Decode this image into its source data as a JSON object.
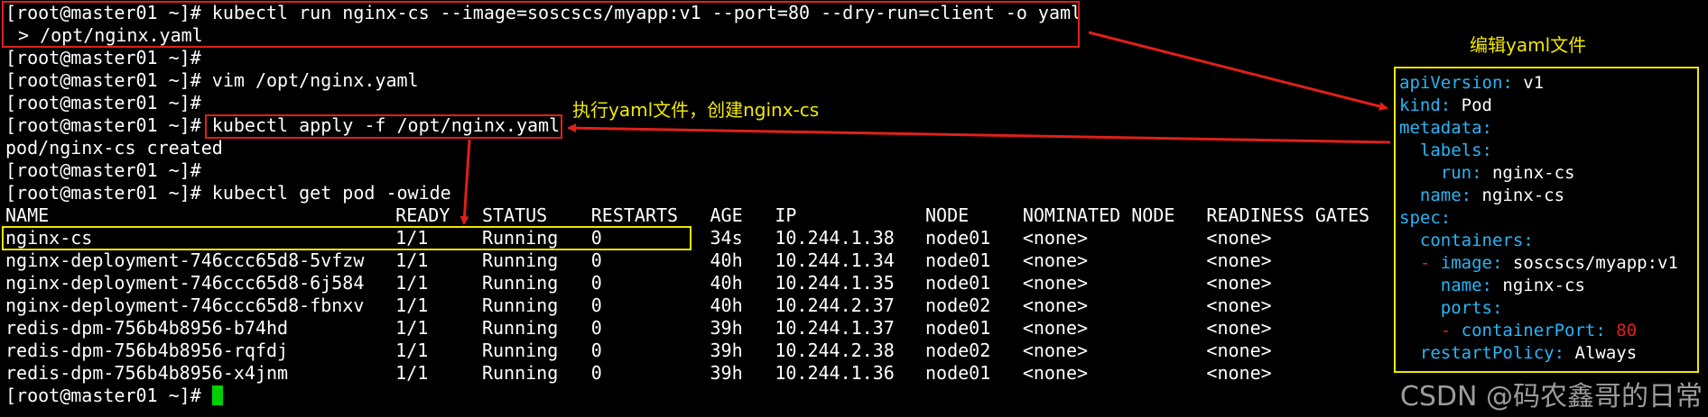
{
  "terminal": {
    "prompt": "[root@master01 ~]#",
    "commands": [
      "kubectl run nginx-cs --image=soscscs/myapp:v1 --port=80 --dry-run=client -o yaml",
      "> /opt/nginx.yaml",
      "vim /opt/nginx.yaml",
      "kubectl apply -f /opt/nginx.yaml",
      "kubectl get pod -owide"
    ],
    "output_created": "pod/nginx-cs created"
  },
  "pod_table": {
    "headers": [
      "NAME",
      "READY",
      "STATUS",
      "RESTARTS",
      "AGE",
      "IP",
      "NODE",
      "NOMINATED NODE",
      "READINESS GATES"
    ],
    "rows": [
      [
        "nginx-cs",
        "1/1",
        "Running",
        "0",
        "34s",
        "10.244.1.38",
        "node01",
        "<none>",
        "<none>"
      ],
      [
        "nginx-deployment-746ccc65d8-5vfzw",
        "1/1",
        "Running",
        "0",
        "40h",
        "10.244.1.34",
        "node01",
        "<none>",
        "<none>"
      ],
      [
        "nginx-deployment-746ccc65d8-6j584",
        "1/1",
        "Running",
        "0",
        "40h",
        "10.244.1.35",
        "node01",
        "<none>",
        "<none>"
      ],
      [
        "nginx-deployment-746ccc65d8-fbnxv",
        "1/1",
        "Running",
        "0",
        "40h",
        "10.244.2.37",
        "node02",
        "<none>",
        "<none>"
      ],
      [
        "redis-dpm-756b4b8956-b74hd",
        "1/1",
        "Running",
        "0",
        "39h",
        "10.244.1.37",
        "node01",
        "<none>",
        "<none>"
      ],
      [
        "redis-dpm-756b4b8956-rqfdj",
        "1/1",
        "Running",
        "0",
        "39h",
        "10.244.2.38",
        "node02",
        "<none>",
        "<none>"
      ],
      [
        "redis-dpm-756b4b8956-x4jnm",
        "1/1",
        "Running",
        "0",
        "39h",
        "10.244.1.36",
        "node01",
        "<none>",
        "<none>"
      ]
    ]
  },
  "annotations": {
    "edit_yaml": "编辑yaml文件",
    "apply_yaml": "执行yaml文件，创建nginx-cs"
  },
  "yaml": {
    "apiVersion_key": "apiVersion",
    "apiVersion_val": "v1",
    "kind_key": "kind",
    "kind_val": "Pod",
    "metadata_key": "metadata",
    "labels_key": "labels",
    "run_key": "run",
    "run_val": "nginx-cs",
    "name_key": "name",
    "name_val": "nginx-cs",
    "spec_key": "spec",
    "containers_key": "containers",
    "image_key": "image",
    "image_val": "soscscs/myapp:v1",
    "cname_key": "name",
    "cname_val": "nginx-cs",
    "ports_key": "ports",
    "containerPort_key": "containerPort",
    "containerPort_val": "80",
    "restartPolicy_key": "restartPolicy",
    "restartPolicy_val": "Always"
  },
  "watermark": "CSDN @码农鑫哥的日常",
  "colors": {
    "background": "#000000",
    "text": "#ffffff",
    "highlight_red": "#e0201a",
    "highlight_yellow": "#f0e800",
    "yaml_key": "#29b6f6",
    "cursor": "#00d000"
  }
}
